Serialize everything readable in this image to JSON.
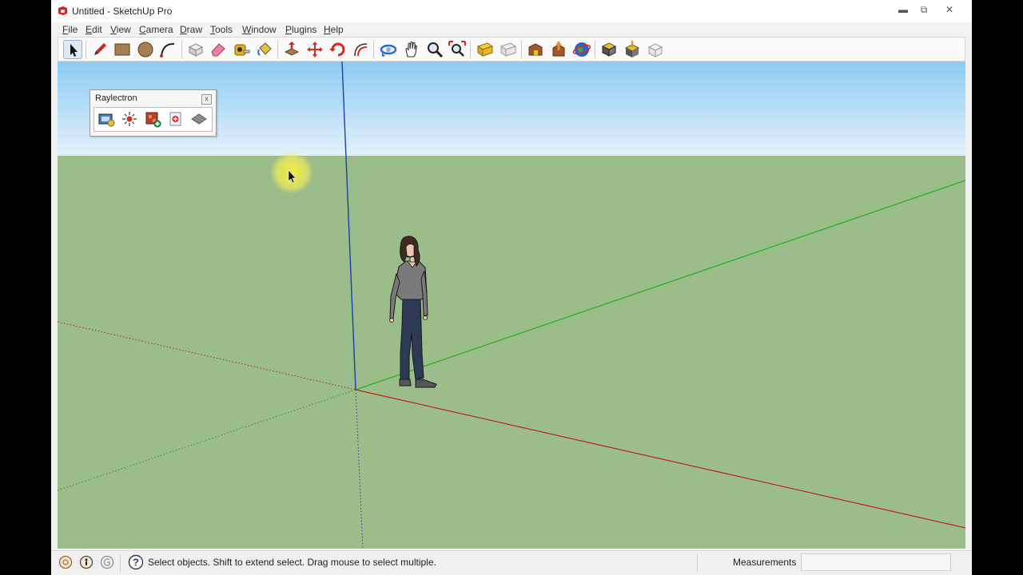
{
  "window": {
    "title": "Untitled - SketchUp Pro",
    "controls": [
      "minimize",
      "restore",
      "close"
    ]
  },
  "menubar": {
    "items": [
      "File",
      "Edit",
      "View",
      "Camera",
      "Draw",
      "Tools",
      "Window",
      "Plugins",
      "Help"
    ]
  },
  "toolbar": {
    "tools": [
      {
        "name": "select",
        "icon": "arrow-cursor-icon"
      },
      {
        "name": "pencil",
        "icon": "pencil-icon"
      },
      {
        "name": "rectangle",
        "icon": "rectangle-icon"
      },
      {
        "name": "circle",
        "icon": "circle-icon"
      },
      {
        "name": "arc",
        "icon": "arc-icon"
      },
      {
        "name": "make-component",
        "icon": "component-icon"
      },
      {
        "name": "eraser",
        "icon": "eraser-icon"
      },
      {
        "name": "tape-measure",
        "icon": "tape-measure-icon"
      },
      {
        "name": "paint-bucket",
        "icon": "paint-bucket-icon"
      },
      {
        "name": "push-pull",
        "icon": "push-pull-icon"
      },
      {
        "name": "move",
        "icon": "move-icon"
      },
      {
        "name": "rotate",
        "icon": "rotate-icon"
      },
      {
        "name": "offset",
        "icon": "offset-icon"
      },
      {
        "name": "orbit",
        "icon": "orbit-icon"
      },
      {
        "name": "pan",
        "icon": "hand-icon"
      },
      {
        "name": "zoom",
        "icon": "zoom-icon"
      },
      {
        "name": "zoom-extents",
        "icon": "zoom-extents-icon"
      },
      {
        "name": "previous-view",
        "icon": "previous-view-icon"
      },
      {
        "name": "next-view",
        "icon": "next-view-icon"
      },
      {
        "name": "get-models",
        "icon": "warehouse-icon"
      },
      {
        "name": "share-model",
        "icon": "share-model-icon"
      },
      {
        "name": "google-earth",
        "icon": "globe-icon"
      },
      {
        "name": "get-components",
        "icon": "get-components-icon"
      },
      {
        "name": "share-component",
        "icon": "share-component-icon"
      },
      {
        "name": "extension-warehouse",
        "icon": "extension-icon"
      }
    ]
  },
  "raylectron": {
    "title": "Raylectron",
    "close_label": "x",
    "tools": [
      "render-icon",
      "light-icon",
      "material-icon",
      "add-emitter-icon",
      "texture-icon"
    ]
  },
  "statusbar": {
    "status_text": "Select objects. Shift to extend select. Drag mouse to select multiple.",
    "measurements_label": "Measurements",
    "measurements_value": "",
    "icons": [
      "geo-location-icon",
      "credits-icon",
      "sign-in-icon",
      "help-icon"
    ]
  },
  "colors": {
    "sky_top": "#8ccbf2",
    "sky_bottom": "#e3f1fb",
    "ground": "#9bbd89",
    "axis_red": "#c0201a",
    "axis_green": "#22b022",
    "axis_blue": "#1d3fae"
  }
}
